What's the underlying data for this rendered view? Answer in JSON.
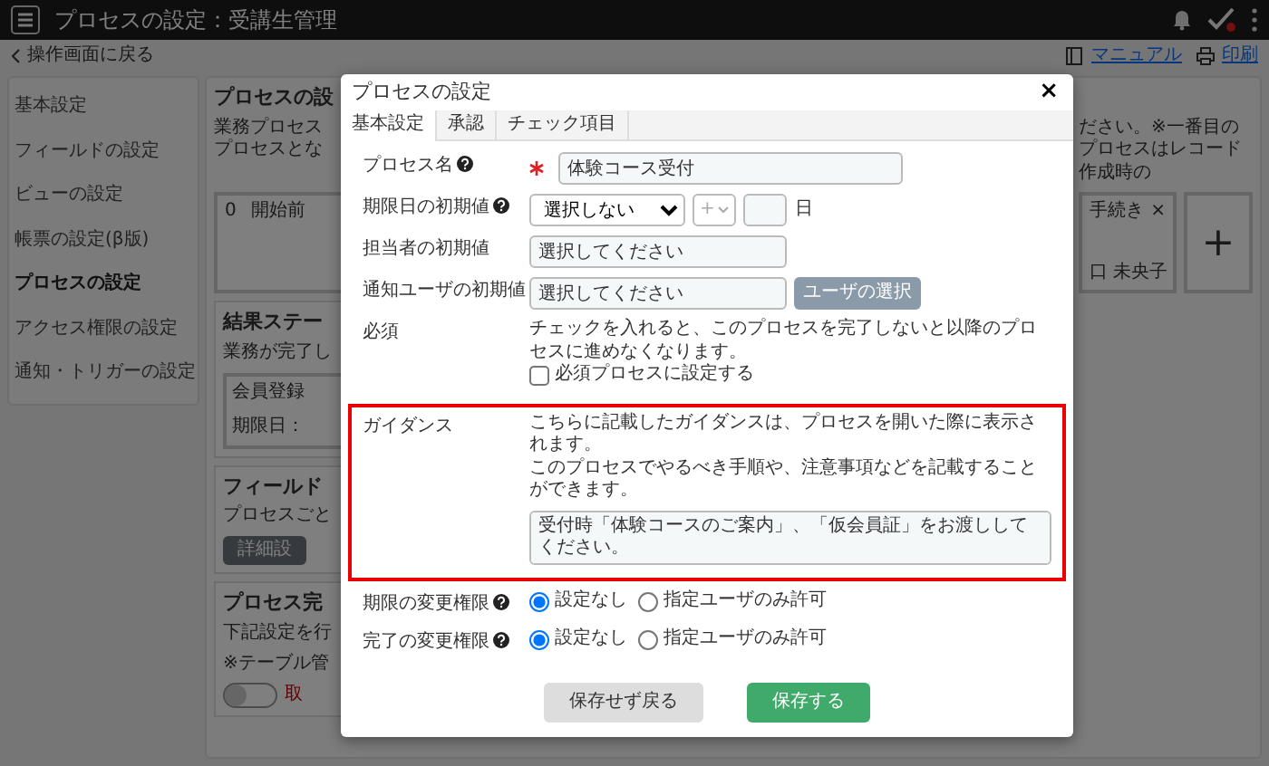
{
  "app_bar": {
    "title": "プロセスの設定：受講生管理"
  },
  "subbar": {
    "back_link": "操作画面に戻る",
    "links": [
      {
        "kind": "manual",
        "label": "マニュアル"
      },
      {
        "kind": "print",
        "label": "印刷"
      }
    ]
  },
  "sidebar": {
    "items": [
      {
        "label": "基本設定",
        "selected": false
      },
      {
        "label": "フィールドの設定",
        "selected": false
      },
      {
        "label": "ビューの設定",
        "selected": false
      },
      {
        "label": "帳票の設定(β版)",
        "selected": false
      },
      {
        "label": "プロセスの設定",
        "selected": true
      },
      {
        "label": "アクセス権限の設定",
        "selected": false
      },
      {
        "label": "通知・トリガーの設定",
        "selected": false
      }
    ]
  },
  "background": {
    "title": "プロセスの設",
    "description_left": [
      "業務プロセス",
      "プロセスとな"
    ],
    "description_right": "ださい。※一番目のプロセスはレコード作成時の",
    "process_cards": [
      {
        "kind": "process",
        "number": "0",
        "name": "開始前"
      },
      {
        "kind": "process",
        "name": "手続き",
        "close": "×",
        "assignee": "口 未央子"
      },
      {
        "kind": "add",
        "symbol": "+"
      }
    ],
    "sections": [
      {
        "title": "結果ステー",
        "lines": [
          "業務が完了し"
        ],
        "card": {
          "name": "会員登録",
          "deadline": "期限日："
        }
      },
      {
        "title": "フィールド",
        "lines": [
          "プロセスごと"
        ],
        "button": "詳細設"
      },
      {
        "title": "プロセス完",
        "lines": [
          "下記設定を行",
          "※テーブル管"
        ],
        "toggle": {
          "on": false
        },
        "toggle_text": "取"
      }
    ]
  },
  "dialog": {
    "title": "プロセスの設定",
    "close": "×",
    "tabs": [
      {
        "label": "基本設定",
        "selected": true
      },
      {
        "label": "承認",
        "selected": false
      },
      {
        "label": "チェック項目",
        "selected": false
      }
    ],
    "fields": [
      {
        "kind": "text",
        "label": "プロセス名",
        "help": true,
        "required": true,
        "value": "体験コース受付"
      },
      {
        "kind": "deadline",
        "label": "期限日の初期値",
        "help": true,
        "select": "選択しない",
        "sign": "+",
        "unit": "日"
      },
      {
        "kind": "text",
        "label": "担当者の初期値",
        "placeholder": "選択してください"
      },
      {
        "kind": "user",
        "label": "通知ユーザの初期値",
        "placeholder": "選択してください",
        "button": "ユーザの選択"
      },
      {
        "kind": "checkbox",
        "label": "必須",
        "note": "チェックを入れると、このプロセスを完了しないと以降のプロセスに進めなくなります。",
        "option": "必須プロセスに設定する",
        "checked": false
      },
      {
        "kind": "textarea",
        "label": "ガイダンス",
        "highlighted": true,
        "notes": [
          "こちらに記載したガイダンスは、プロセスを開いた際に表示されます。",
          "このプロセスでやるべき手順や、注意事項などを記載することができます。"
        ],
        "value": "受付時「体験コースのご案内」、「仮会員証」をお渡ししてください。"
      },
      {
        "kind": "radio",
        "label": "期限の変更権限",
        "help": true,
        "options": [
          {
            "label": "設定なし",
            "selected": true
          },
          {
            "label": "指定ユーザのみ許可",
            "selected": false
          }
        ]
      },
      {
        "kind": "radio",
        "label": "完了の変更権限",
        "help": true,
        "options": [
          {
            "label": "設定なし",
            "selected": true
          },
          {
            "label": "指定ユーザのみ許可",
            "selected": false
          }
        ]
      }
    ],
    "buttons": [
      {
        "kind": "secondary",
        "label": "保存せず戻る"
      },
      {
        "kind": "primary",
        "label": "保存する"
      }
    ]
  }
}
